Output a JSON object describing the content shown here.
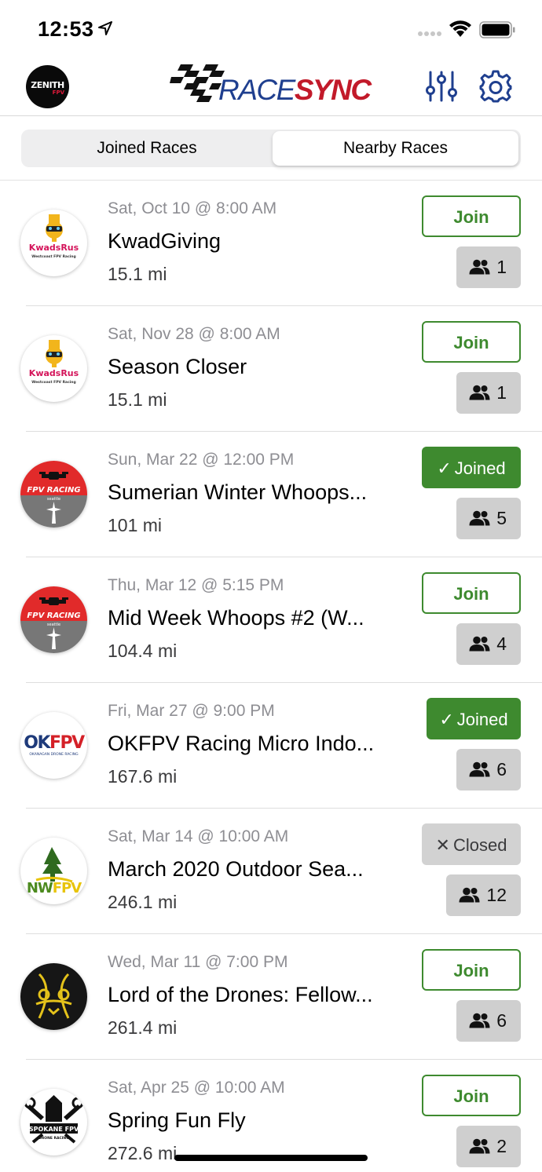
{
  "status_bar": {
    "time": "12:53"
  },
  "nav": {
    "avatar_text": "ZENITH",
    "avatar_sub": "FPV",
    "logo_race": "RACE",
    "logo_sync": "SYNC"
  },
  "tabs": {
    "joined": "Joined Races",
    "nearby": "Nearby Races",
    "selected": "nearby"
  },
  "colors": {
    "join_green": "#3e8a2f",
    "brand_blue": "#1f3f8f",
    "brand_red": "#c21a2a"
  },
  "races": [
    {
      "date": "Sat, Oct 10 @ 8:00 AM",
      "name": "KwadGiving",
      "distance": "15.1 mi",
      "status": "join",
      "status_label": "Join",
      "count": "1",
      "logo": "kwadsrus-icon"
    },
    {
      "date": "Sat, Nov 28 @ 8:00 AM",
      "name": "Season Closer",
      "distance": "15.1 mi",
      "status": "join",
      "status_label": "Join",
      "count": "1",
      "logo": "kwadsrus-icon"
    },
    {
      "date": "Sun, Mar 22 @ 12:00 PM",
      "name": "Sumerian Winter Whoops...",
      "distance": "101 mi",
      "status": "joined",
      "status_label": "Joined",
      "count": "5",
      "logo": "fpv-racing-seattle-icon"
    },
    {
      "date": "Thu, Mar 12 @ 5:15 PM",
      "name": "Mid Week Whoops #2 (W...",
      "distance": "104.4 mi",
      "status": "join",
      "status_label": "Join",
      "count": "4",
      "logo": "fpv-racing-seattle-icon"
    },
    {
      "date": "Fri, Mar 27 @ 9:00 PM",
      "name": "OKFPV Racing Micro Indo...",
      "distance": "167.6 mi",
      "status": "joined",
      "status_label": "Joined",
      "count": "6",
      "logo": "okfpv-icon"
    },
    {
      "date": "Sat, Mar 14 @ 10:00 AM",
      "name": "March 2020 Outdoor Sea...",
      "distance": "246.1 mi",
      "status": "closed",
      "status_label": "Closed",
      "count": "12",
      "logo": "nwfpv-icon"
    },
    {
      "date": "Wed, Mar 11 @ 7:00 PM",
      "name": "Lord of the Drones: Fellow...",
      "distance": "261.4 mi",
      "status": "join",
      "status_label": "Join",
      "count": "6",
      "logo": "lord-of-the-drones-icon"
    },
    {
      "date": "Sat, Apr 25 @ 10:00 AM",
      "name": "Spring Fun Fly",
      "distance": "272.6 mi",
      "status": "join",
      "status_label": "Join",
      "count": "2",
      "logo": "spokane-fpv-icon"
    }
  ]
}
